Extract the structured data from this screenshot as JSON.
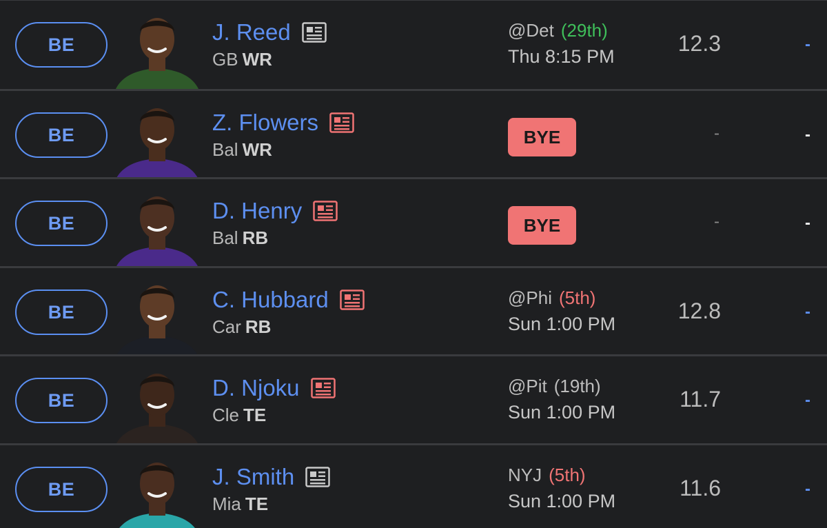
{
  "colors": {
    "background": "#1e1f21",
    "accent_blue": "#5d8ff0",
    "bye_red": "#f07474",
    "rank_green": "#3fbf5a",
    "rank_red": "#f07474",
    "rank_neutral": "#bdbdbd"
  },
  "players": [
    {
      "slot": "BE",
      "name": "J. Reed",
      "team": "GB",
      "position": "WR",
      "news_color": "#c9c9c9",
      "opponent": "@Det",
      "rank": "(29th)",
      "rank_color": "#3fbf5a",
      "game_time": "Thu 8:15 PM",
      "bye": "",
      "projection": "12.3",
      "actual": "-",
      "jersey_color": "#2f5a2a",
      "skin_color": "#5b3a25"
    },
    {
      "slot": "BE",
      "name": "Z. Flowers",
      "team": "Bal",
      "position": "WR",
      "news_color": "#f07474",
      "opponent": "",
      "rank": "",
      "rank_color": "#bdbdbd",
      "game_time": "",
      "bye": "BYE",
      "projection": "-",
      "actual": "-",
      "jersey_color": "#4a2a8a",
      "skin_color": "#4a2e1e"
    },
    {
      "slot": "BE",
      "name": "D. Henry",
      "team": "Bal",
      "position": "RB",
      "news_color": "#f07474",
      "opponent": "",
      "rank": "",
      "rank_color": "#bdbdbd",
      "game_time": "",
      "bye": "BYE",
      "projection": "-",
      "actual": "-",
      "jersey_color": "#4a2a8a",
      "skin_color": "#4d3022"
    },
    {
      "slot": "BE",
      "name": "C. Hubbard",
      "team": "Car",
      "position": "RB",
      "news_color": "#f07474",
      "opponent": "@Phi",
      "rank": "(5th)",
      "rank_color": "#f07474",
      "game_time": "Sun 1:00 PM",
      "bye": "",
      "projection": "12.8",
      "actual": "-",
      "jersey_color": "#1c1f26",
      "skin_color": "#5e3c27"
    },
    {
      "slot": "BE",
      "name": "D. Njoku",
      "team": "Cle",
      "position": "TE",
      "news_color": "#f07474",
      "opponent": "@Pit",
      "rank": "(19th)",
      "rank_color": "#bdbdbd",
      "game_time": "Sun 1:00 PM",
      "bye": "",
      "projection": "11.7",
      "actual": "-",
      "jersey_color": "#2b2320",
      "skin_color": "#3e271b"
    },
    {
      "slot": "BE",
      "name": "J. Smith",
      "team": "Mia",
      "position": "TE",
      "news_color": "#c9c9c9",
      "opponent": "NYJ",
      "rank": "(5th)",
      "rank_color": "#f07474",
      "game_time": "Sun 1:00 PM",
      "bye": "",
      "projection": "11.6",
      "actual": "-",
      "jersey_color": "#2aa6a8",
      "skin_color": "#4a2e20"
    }
  ]
}
